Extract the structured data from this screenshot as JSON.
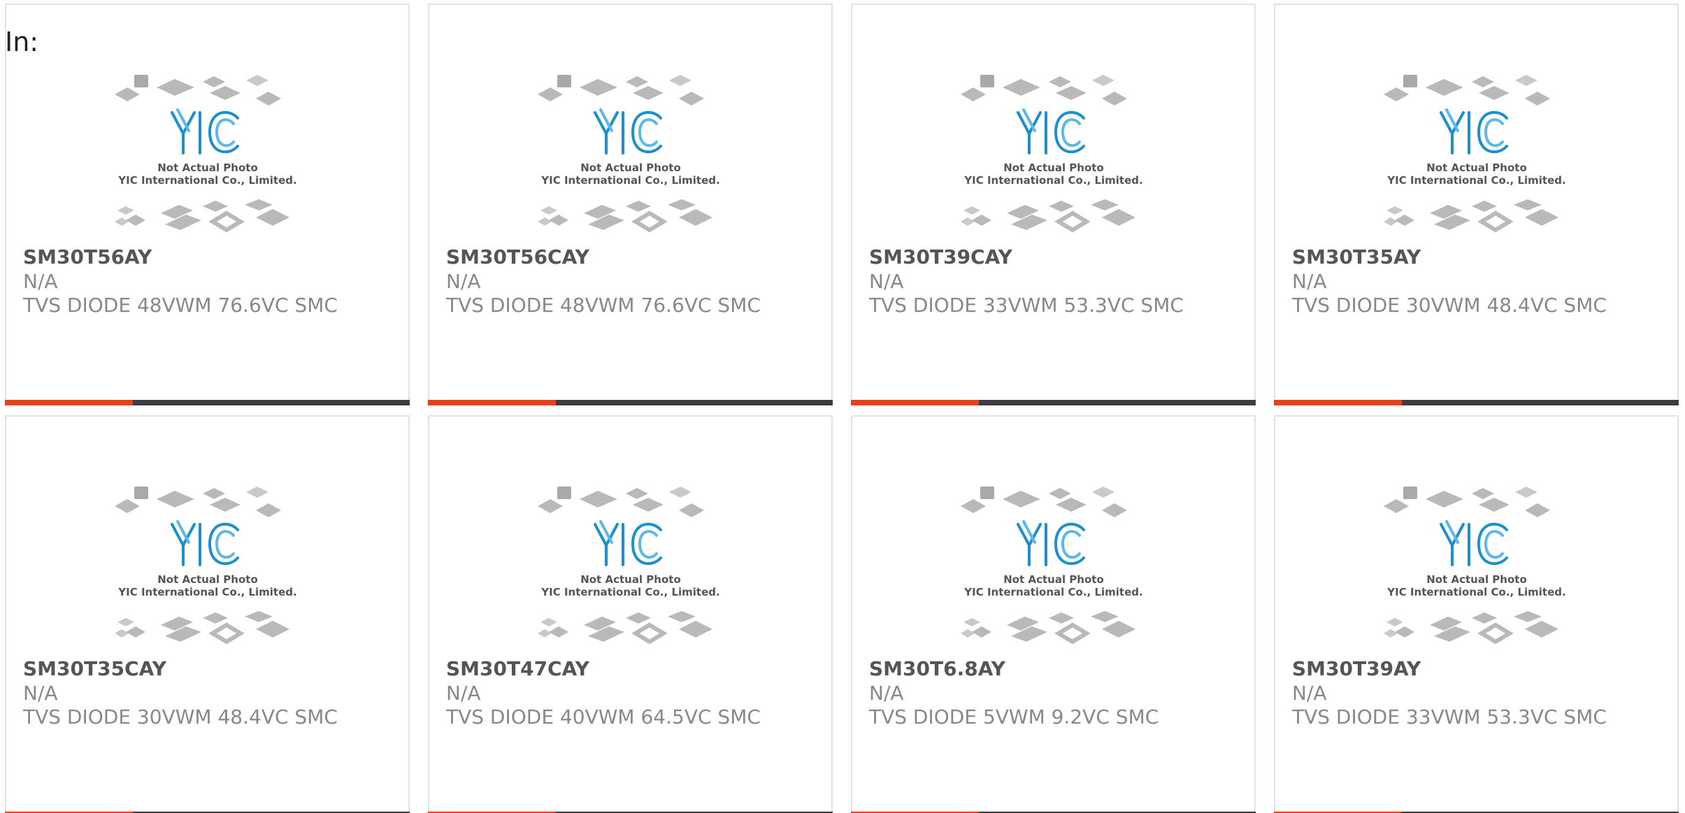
{
  "filter_label": "In:",
  "placeholder_image": {
    "logo_text": "YIC",
    "caption_line1": "Not Actual Photo",
    "caption_line2": "YIC International Co., Limited."
  },
  "colors": {
    "accent": "#e8401b",
    "bar": "#3d3d3d",
    "logo_blue": "#1b8fd0"
  },
  "products": [
    {
      "part_number": "SM30T56AY",
      "manufacturer": "N/A",
      "description": "TVS DIODE 48VWM 76.6VC SMC"
    },
    {
      "part_number": "SM30T56CAY",
      "manufacturer": "N/A",
      "description": "TVS DIODE 48VWM 76.6VC SMC"
    },
    {
      "part_number": "SM30T39CAY",
      "manufacturer": "N/A",
      "description": "TVS DIODE 33VWM 53.3VC SMC"
    },
    {
      "part_number": "SM30T35AY",
      "manufacturer": "N/A",
      "description": "TVS DIODE 30VWM 48.4VC SMC"
    },
    {
      "part_number": "SM30T35CAY",
      "manufacturer": "N/A",
      "description": "TVS DIODE 30VWM 48.4VC SMC"
    },
    {
      "part_number": "SM30T47CAY",
      "manufacturer": "N/A",
      "description": "TVS DIODE 40VWM 64.5VC SMC"
    },
    {
      "part_number": "SM30T6.8AY",
      "manufacturer": "N/A",
      "description": "TVS DIODE 5VWM 9.2VC SMC"
    },
    {
      "part_number": "SM30T39AY",
      "manufacturer": "N/A",
      "description": "TVS DIODE 33VWM 53.3VC SMC"
    }
  ]
}
